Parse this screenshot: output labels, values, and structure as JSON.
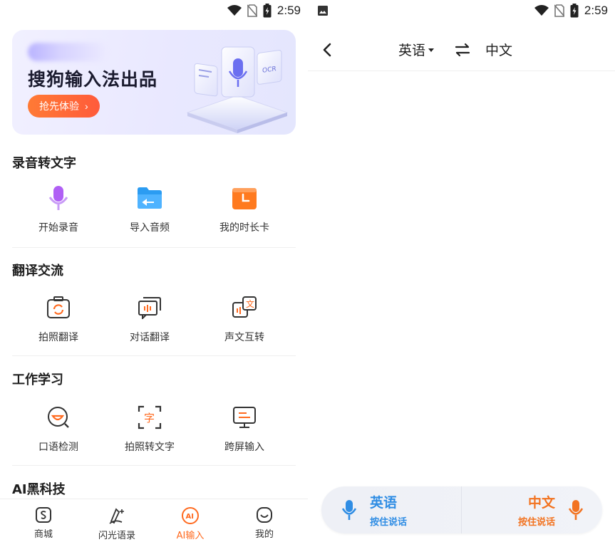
{
  "status_bar": {
    "time": "2:59"
  },
  "left": {
    "banner": {
      "title": "搜狗输入法出品",
      "button_label": "抢先体验",
      "button_arrow": "›"
    },
    "sections": [
      {
        "title": "录音转文字",
        "items": [
          {
            "label": "开始录音",
            "icon": "microphone-icon"
          },
          {
            "label": "导入音频",
            "icon": "folder-icon"
          },
          {
            "label": "我的时长卡",
            "icon": "clock-card-icon"
          }
        ]
      },
      {
        "title": "翻译交流",
        "items": [
          {
            "label": "拍照翻译",
            "icon": "camera-translate-icon"
          },
          {
            "label": "对话翻译",
            "icon": "dialog-translate-icon"
          },
          {
            "label": "声文互转",
            "icon": "voice-text-convert-icon"
          }
        ]
      },
      {
        "title": "工作学习",
        "items": [
          {
            "label": "口语检测",
            "icon": "speech-check-icon"
          },
          {
            "label": "拍照转文字",
            "icon": "photo-to-text-icon"
          },
          {
            "label": "跨屏输入",
            "icon": "cross-screen-icon"
          }
        ]
      },
      {
        "title": "AI黑科技",
        "items": []
      }
    ],
    "tabs": [
      {
        "label": "商城",
        "icon": "mall-icon",
        "active": false
      },
      {
        "label": "闪光语录",
        "icon": "quote-icon",
        "active": false
      },
      {
        "label": "AI输入",
        "icon": "ai-icon",
        "active": true
      },
      {
        "label": "我的",
        "icon": "profile-icon",
        "active": false
      }
    ],
    "ai_icon_text": "AI",
    "photo_text_glyph": "字",
    "voice_text_glyph": "文"
  },
  "right": {
    "source_language": "英语",
    "target_language": "中文",
    "voice_left": {
      "language": "英语",
      "hint": "按住说话"
    },
    "voice_right": {
      "language": "中文",
      "hint": "按住说话"
    }
  },
  "colors": {
    "accent_orange": "#ff6a1f",
    "voice_blue": "#2f8de4",
    "voice_orange": "#f27321"
  }
}
